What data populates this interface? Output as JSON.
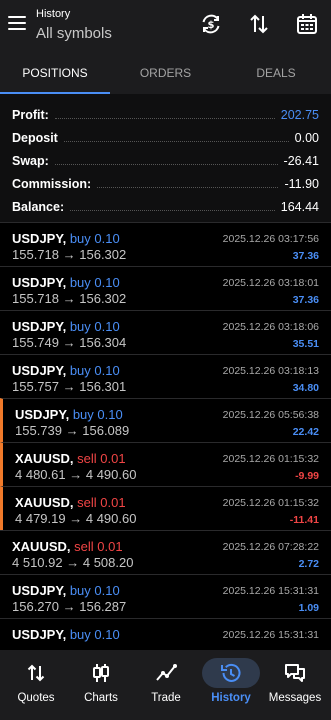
{
  "header": {
    "subtitle": "History",
    "title": "All symbols"
  },
  "tabs": [
    {
      "label": "POSITIONS",
      "active": true
    },
    {
      "label": "ORDERS",
      "active": false
    },
    {
      "label": "DEALS",
      "active": false
    }
  ],
  "summary": [
    {
      "label": "Profit:",
      "value": "202.75",
      "accent": true
    },
    {
      "label": "Deposit",
      "value": "0.00",
      "accent": false
    },
    {
      "label": "Swap:",
      "value": "-26.41",
      "accent": false
    },
    {
      "label": "Commission:",
      "value": "-11.90",
      "accent": false
    },
    {
      "label": "Balance:",
      "value": "164.44",
      "accent": false
    }
  ],
  "trades": [
    {
      "symbol": "USDJPY,",
      "side": "buy",
      "lot": "0.10",
      "open": "155.718",
      "close": "156.302",
      "time": "2025.12.26 03:17:56",
      "profit": "37.36",
      "marked": false
    },
    {
      "symbol": "USDJPY,",
      "side": "buy",
      "lot": "0.10",
      "open": "155.718",
      "close": "156.302",
      "time": "2025.12.26 03:18:01",
      "profit": "37.36",
      "marked": false
    },
    {
      "symbol": "USDJPY,",
      "side": "buy",
      "lot": "0.10",
      "open": "155.749",
      "close": "156.304",
      "time": "2025.12.26 03:18:06",
      "profit": "35.51",
      "marked": false
    },
    {
      "symbol": "USDJPY,",
      "side": "buy",
      "lot": "0.10",
      "open": "155.757",
      "close": "156.301",
      "time": "2025.12.26 03:18:13",
      "profit": "34.80",
      "marked": false
    },
    {
      "symbol": "USDJPY,",
      "side": "buy",
      "lot": "0.10",
      "open": "155.739",
      "close": "156.089",
      "time": "2025.12.26 05:56:38",
      "profit": "22.42",
      "marked": true
    },
    {
      "symbol": "XAUUSD,",
      "side": "sell",
      "lot": "0.01",
      "open": "4 480.61",
      "close": "4 490.60",
      "time": "2025.12.26 01:15:32",
      "profit": "-9.99",
      "marked": true
    },
    {
      "symbol": "XAUUSD,",
      "side": "sell",
      "lot": "0.01",
      "open": "4 479.19",
      "close": "4 490.60",
      "time": "2025.12.26 01:15:32",
      "profit": "-11.41",
      "marked": true
    },
    {
      "symbol": "XAUUSD,",
      "side": "sell",
      "lot": "0.01",
      "open": "4 510.92",
      "close": "4 508.20",
      "time": "2025.12.26 07:28:22",
      "profit": "2.72",
      "marked": false
    },
    {
      "symbol": "USDJPY,",
      "side": "buy",
      "lot": "0.10",
      "open": "156.270",
      "close": "156.287",
      "time": "2025.12.26 15:31:31",
      "profit": "1.09",
      "marked": false
    },
    {
      "symbol": "USDJPY,",
      "side": "buy",
      "lot": "0.10",
      "open": "",
      "close": "",
      "time": "2025.12.26 15:31:31",
      "profit": "",
      "marked": false
    }
  ],
  "nav": [
    {
      "label": "Quotes",
      "icon": "quotes-arrows-icon",
      "active": false
    },
    {
      "label": "Charts",
      "icon": "candlestick-icon",
      "active": false
    },
    {
      "label": "Trade",
      "icon": "trend-line-icon",
      "active": false
    },
    {
      "label": "History",
      "icon": "history-clock-icon",
      "active": true
    },
    {
      "label": "Messages",
      "icon": "chat-bubbles-icon",
      "active": false
    }
  ],
  "colors": {
    "accent": "#4a8ef5",
    "negative": "#f04545",
    "marker": "#f07a2a"
  },
  "arrow": "→"
}
